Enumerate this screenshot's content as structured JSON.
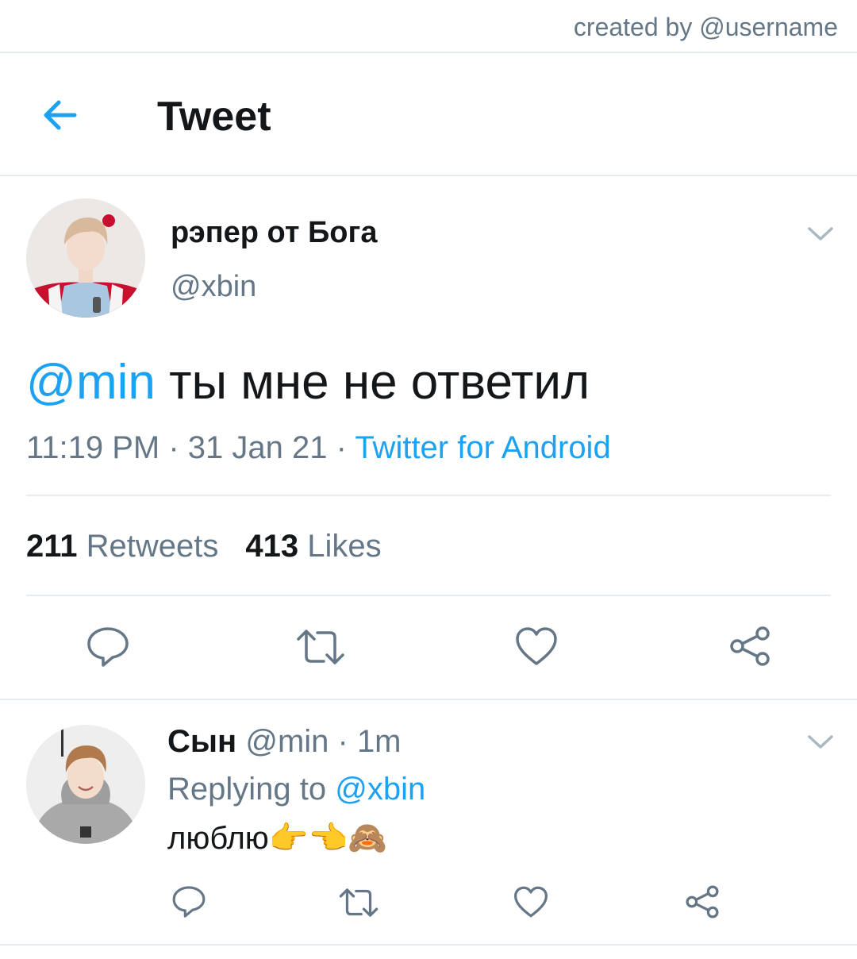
{
  "credit": "created by @username",
  "header": {
    "title": "Tweet"
  },
  "tweet": {
    "author_name": "рэпер от Бога",
    "author_handle": "@xbin",
    "mention": "@min",
    "text": " ты мне не ответил",
    "time": "11:19 PM · 31 Jan 21 · ",
    "source": "Twitter for Android",
    "retweets_count": "211",
    "retweets_label": " Retweets",
    "likes_count": "413",
    "likes_label": " Likes"
  },
  "reply": {
    "author_name": "Сын",
    "meta": " @min · 1m",
    "replying_prefix": "Replying to ",
    "replying_handle": "@xbin",
    "text": "люблю👉👈🙈"
  },
  "colors": {
    "accent": "#1da1f2",
    "secondary_text": "#657786",
    "primary_text": "#14171a",
    "divider": "#e6ecf0",
    "icon_gray": "#657786"
  },
  "icons": {
    "back": "arrow-left-icon",
    "caret": "chevron-down-icon",
    "reply": "comment-icon",
    "retweet": "retweet-icon",
    "like": "heart-icon",
    "share": "share-icon"
  }
}
